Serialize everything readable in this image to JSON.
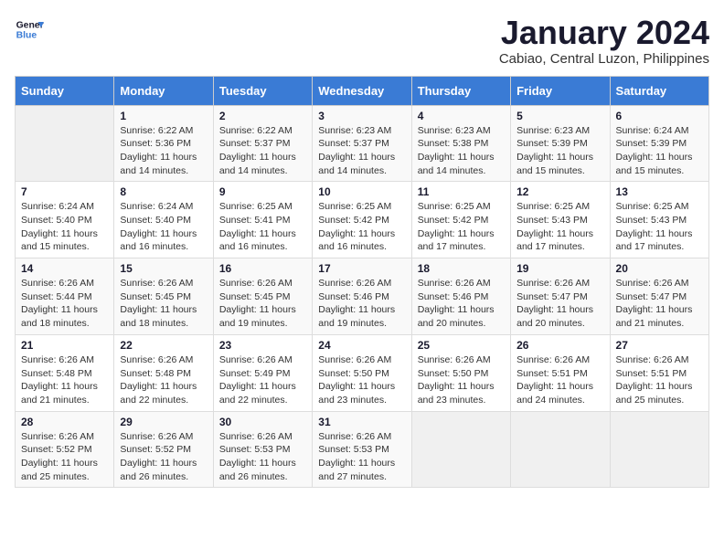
{
  "logo": {
    "line1": "General",
    "line2": "Blue"
  },
  "title": "January 2024",
  "subtitle": "Cabiao, Central Luzon, Philippines",
  "days_of_week": [
    "Sunday",
    "Monday",
    "Tuesday",
    "Wednesday",
    "Thursday",
    "Friday",
    "Saturday"
  ],
  "weeks": [
    [
      {
        "day": "",
        "info": ""
      },
      {
        "day": "1",
        "info": "Sunrise: 6:22 AM\nSunset: 5:36 PM\nDaylight: 11 hours\nand 14 minutes."
      },
      {
        "day": "2",
        "info": "Sunrise: 6:22 AM\nSunset: 5:37 PM\nDaylight: 11 hours\nand 14 minutes."
      },
      {
        "day": "3",
        "info": "Sunrise: 6:23 AM\nSunset: 5:37 PM\nDaylight: 11 hours\nand 14 minutes."
      },
      {
        "day": "4",
        "info": "Sunrise: 6:23 AM\nSunset: 5:38 PM\nDaylight: 11 hours\nand 14 minutes."
      },
      {
        "day": "5",
        "info": "Sunrise: 6:23 AM\nSunset: 5:39 PM\nDaylight: 11 hours\nand 15 minutes."
      },
      {
        "day": "6",
        "info": "Sunrise: 6:24 AM\nSunset: 5:39 PM\nDaylight: 11 hours\nand 15 minutes."
      }
    ],
    [
      {
        "day": "7",
        "info": "Sunrise: 6:24 AM\nSunset: 5:40 PM\nDaylight: 11 hours\nand 15 minutes."
      },
      {
        "day": "8",
        "info": "Sunrise: 6:24 AM\nSunset: 5:40 PM\nDaylight: 11 hours\nand 16 minutes."
      },
      {
        "day": "9",
        "info": "Sunrise: 6:25 AM\nSunset: 5:41 PM\nDaylight: 11 hours\nand 16 minutes."
      },
      {
        "day": "10",
        "info": "Sunrise: 6:25 AM\nSunset: 5:42 PM\nDaylight: 11 hours\nand 16 minutes."
      },
      {
        "day": "11",
        "info": "Sunrise: 6:25 AM\nSunset: 5:42 PM\nDaylight: 11 hours\nand 17 minutes."
      },
      {
        "day": "12",
        "info": "Sunrise: 6:25 AM\nSunset: 5:43 PM\nDaylight: 11 hours\nand 17 minutes."
      },
      {
        "day": "13",
        "info": "Sunrise: 6:25 AM\nSunset: 5:43 PM\nDaylight: 11 hours\nand 17 minutes."
      }
    ],
    [
      {
        "day": "14",
        "info": "Sunrise: 6:26 AM\nSunset: 5:44 PM\nDaylight: 11 hours\nand 18 minutes."
      },
      {
        "day": "15",
        "info": "Sunrise: 6:26 AM\nSunset: 5:45 PM\nDaylight: 11 hours\nand 18 minutes."
      },
      {
        "day": "16",
        "info": "Sunrise: 6:26 AM\nSunset: 5:45 PM\nDaylight: 11 hours\nand 19 minutes."
      },
      {
        "day": "17",
        "info": "Sunrise: 6:26 AM\nSunset: 5:46 PM\nDaylight: 11 hours\nand 19 minutes."
      },
      {
        "day": "18",
        "info": "Sunrise: 6:26 AM\nSunset: 5:46 PM\nDaylight: 11 hours\nand 20 minutes."
      },
      {
        "day": "19",
        "info": "Sunrise: 6:26 AM\nSunset: 5:47 PM\nDaylight: 11 hours\nand 20 minutes."
      },
      {
        "day": "20",
        "info": "Sunrise: 6:26 AM\nSunset: 5:47 PM\nDaylight: 11 hours\nand 21 minutes."
      }
    ],
    [
      {
        "day": "21",
        "info": "Sunrise: 6:26 AM\nSunset: 5:48 PM\nDaylight: 11 hours\nand 21 minutes."
      },
      {
        "day": "22",
        "info": "Sunrise: 6:26 AM\nSunset: 5:48 PM\nDaylight: 11 hours\nand 22 minutes."
      },
      {
        "day": "23",
        "info": "Sunrise: 6:26 AM\nSunset: 5:49 PM\nDaylight: 11 hours\nand 22 minutes."
      },
      {
        "day": "24",
        "info": "Sunrise: 6:26 AM\nSunset: 5:50 PM\nDaylight: 11 hours\nand 23 minutes."
      },
      {
        "day": "25",
        "info": "Sunrise: 6:26 AM\nSunset: 5:50 PM\nDaylight: 11 hours\nand 23 minutes."
      },
      {
        "day": "26",
        "info": "Sunrise: 6:26 AM\nSunset: 5:51 PM\nDaylight: 11 hours\nand 24 minutes."
      },
      {
        "day": "27",
        "info": "Sunrise: 6:26 AM\nSunset: 5:51 PM\nDaylight: 11 hours\nand 25 minutes."
      }
    ],
    [
      {
        "day": "28",
        "info": "Sunrise: 6:26 AM\nSunset: 5:52 PM\nDaylight: 11 hours\nand 25 minutes."
      },
      {
        "day": "29",
        "info": "Sunrise: 6:26 AM\nSunset: 5:52 PM\nDaylight: 11 hours\nand 26 minutes."
      },
      {
        "day": "30",
        "info": "Sunrise: 6:26 AM\nSunset: 5:53 PM\nDaylight: 11 hours\nand 26 minutes."
      },
      {
        "day": "31",
        "info": "Sunrise: 6:26 AM\nSunset: 5:53 PM\nDaylight: 11 hours\nand 27 minutes."
      },
      {
        "day": "",
        "info": ""
      },
      {
        "day": "",
        "info": ""
      },
      {
        "day": "",
        "info": ""
      }
    ]
  ]
}
